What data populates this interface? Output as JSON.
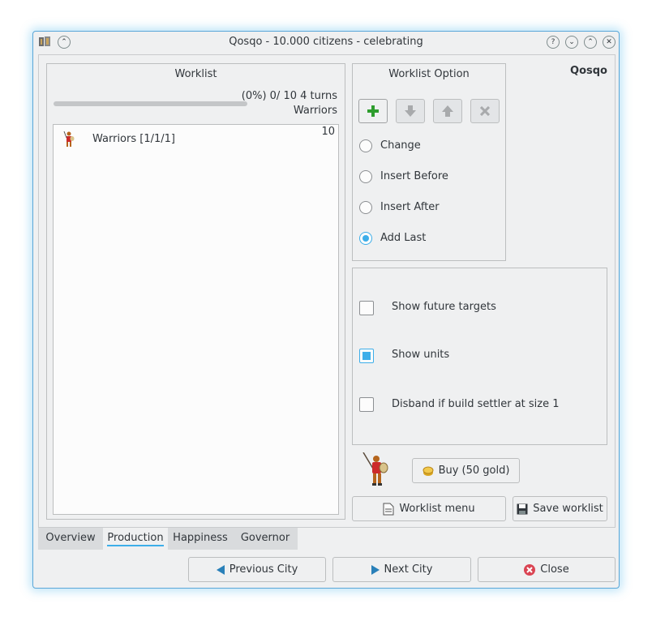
{
  "window": {
    "title": "Qosqo - 10.000 citizens - celebrating",
    "city_name": "Qosqo",
    "title_buttons": [
      "?",
      "⌄",
      "⌃",
      "✕"
    ]
  },
  "worklist": {
    "header": "Worklist",
    "progress_text": "(0%) 0/ 10 4 turns",
    "progress_fraction": 0.0,
    "current_item": "Warriors",
    "items": [
      {
        "label": "Warriors [1/1/1]",
        "cost": "10"
      }
    ]
  },
  "worklist_option": {
    "header": "Worklist Option",
    "tool_buttons": [
      "add-icon",
      "move-down-icon",
      "move-up-icon",
      "delete-icon"
    ],
    "radios": [
      {
        "label": "Change",
        "checked": false
      },
      {
        "label": "Insert Before",
        "checked": false
      },
      {
        "label": "Insert After",
        "checked": false
      },
      {
        "label": "Add Last",
        "checked": true
      }
    ]
  },
  "options": {
    "checkboxes": [
      {
        "label": "Show future targets",
        "checked": false
      },
      {
        "label": "Show units",
        "checked": true
      },
      {
        "label": "Disband if build settler at size 1",
        "checked": false
      }
    ]
  },
  "actions": {
    "buy_label": "Buy (50 gold)",
    "worklist_menu_label": "Worklist menu",
    "save_worklist_label": "Save worklist"
  },
  "tabs": [
    {
      "label": "Overview",
      "active": false
    },
    {
      "label": "Production",
      "active": true
    },
    {
      "label": "Happiness",
      "active": false
    },
    {
      "label": "Governor",
      "active": false
    }
  ],
  "navigation": {
    "previous_label": "Previous City",
    "next_label": "Next City",
    "close_label": "Close"
  },
  "colors": {
    "accent": "#3daee9",
    "window_bg": "#eff0f1",
    "add_green": "#2e9d2e",
    "close_red": "#da4453"
  }
}
